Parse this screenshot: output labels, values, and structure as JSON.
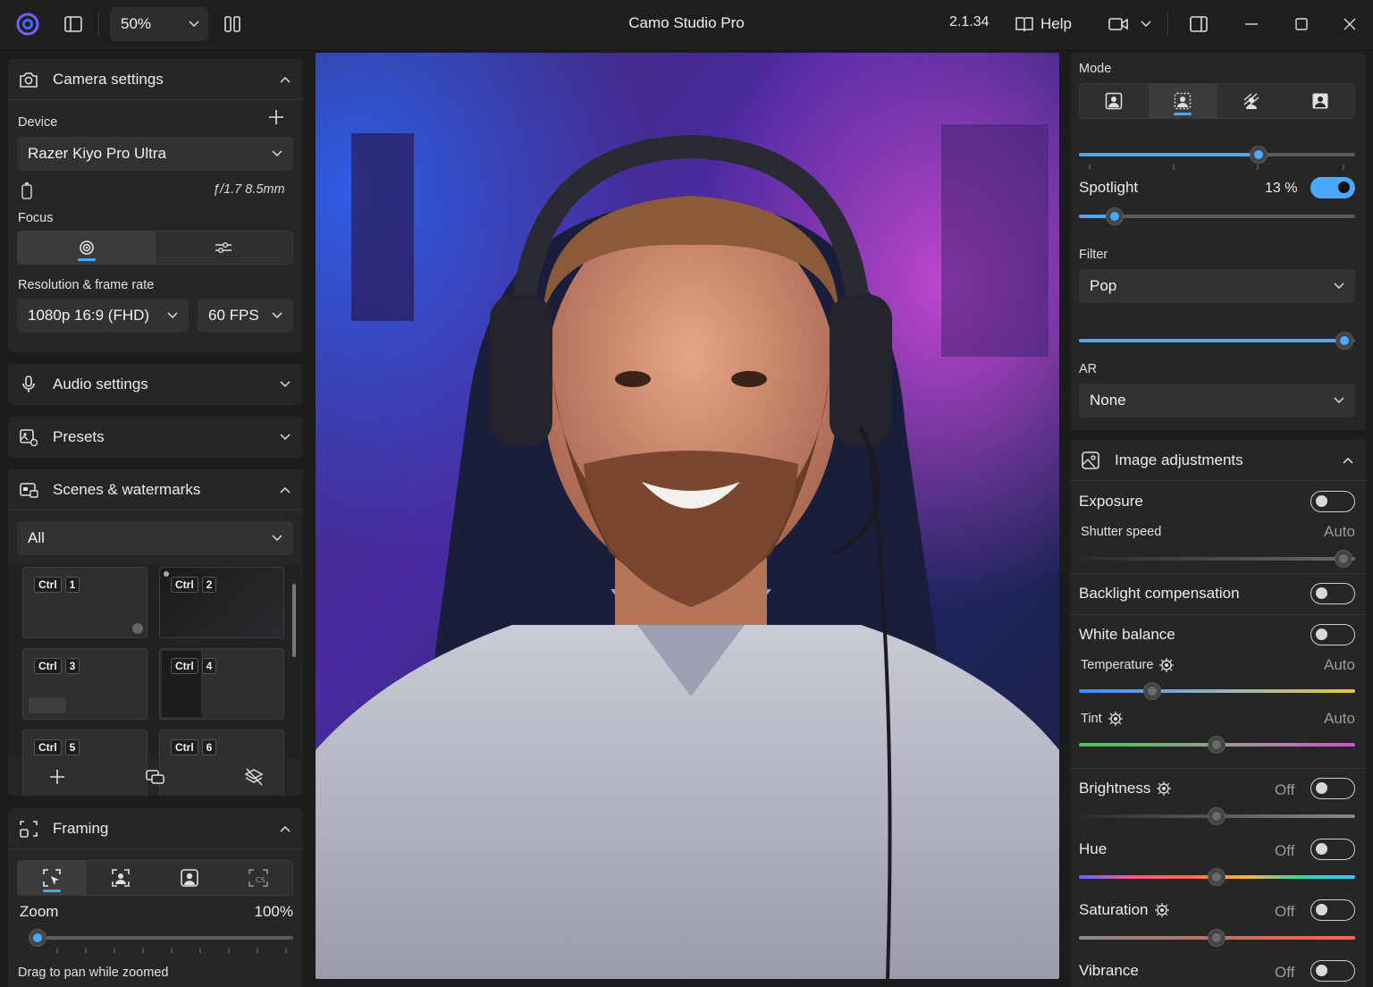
{
  "titlebar": {
    "zoom": "50%",
    "title": "Camo Studio Pro",
    "version": "2.1.34",
    "help": "Help"
  },
  "camera": {
    "title": "Camera settings",
    "device_label": "Device",
    "device": "Razer Kiyo Pro Ultra",
    "lens": "ƒ/1.7 8.5mm",
    "focus_label": "Focus",
    "res_label": "Resolution & frame rate",
    "resolution": "1080p 16:9 (FHD)",
    "fps": "60 FPS"
  },
  "audio": {
    "title": "Audio settings"
  },
  "presets": {
    "title": "Presets"
  },
  "scenes": {
    "title": "Scenes & watermarks",
    "filter": "All",
    "items": [
      {
        "mod": "Ctrl",
        "key": "1"
      },
      {
        "mod": "Ctrl",
        "key": "2"
      },
      {
        "mod": "Ctrl",
        "key": "3"
      },
      {
        "mod": "Ctrl",
        "key": "4"
      },
      {
        "mod": "Ctrl",
        "key": "5"
      },
      {
        "mod": "Ctrl",
        "key": "6"
      }
    ]
  },
  "framing": {
    "title": "Framing",
    "zoom_label": "Zoom",
    "zoom_value": "100%",
    "zoom_level": 0,
    "hint": "Drag to pan while zoomed"
  },
  "mode": {
    "label": "Mode",
    "slider_level": 0.65,
    "spotlight_label": "Spotlight",
    "spotlight_value": "13 %",
    "spotlight_on": true,
    "spotlight_level": 0.13,
    "filter_label": "Filter",
    "filter": "Pop",
    "filter_level": 0.96,
    "ar_label": "AR",
    "ar": "None"
  },
  "image": {
    "title": "Image adjustments",
    "exposure": "Exposure",
    "shutter_label": "Shutter speed",
    "shutter_value": "Auto",
    "backlight": "Backlight compensation",
    "white_balance": "White balance",
    "temperature_label": "Temperature",
    "temperature_value": "Auto",
    "tint_label": "Tint",
    "tint_value": "Auto",
    "brightness": "Brightness",
    "brightness_value": "Off",
    "hue": "Hue",
    "hue_value": "Off",
    "saturation": "Saturation",
    "saturation_value": "Off",
    "vibrance": "Vibrance",
    "vibrance_value": "Off"
  },
  "colors": {
    "accent": "#4aa8ff",
    "panel": "#262626",
    "bg": "#1c1c1c"
  }
}
